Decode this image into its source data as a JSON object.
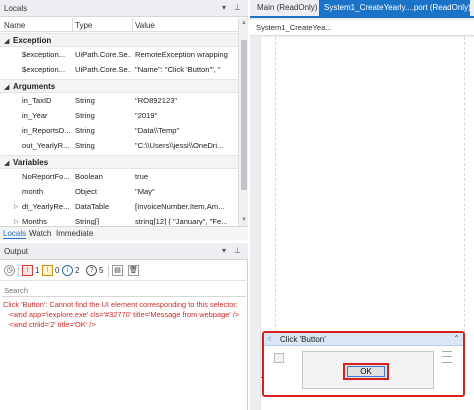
{
  "locals": {
    "title": "Locals",
    "columns": [
      "Name",
      "Type",
      "Value"
    ],
    "groups": [
      {
        "label": "Exception",
        "rows": [
          {
            "name": "$exception...",
            "type": "UiPath.Core.Se...",
            "value": "RemoteException wrapping"
          },
          {
            "name": "$exception...",
            "type": "UiPath.Core.Se...",
            "value": "\"Name\": \"Click 'Button'\",  \""
          }
        ]
      },
      {
        "label": "Arguments",
        "rows": [
          {
            "name": "in_TaxID",
            "type": "String",
            "value": "\"RO892123\""
          },
          {
            "name": "in_Year",
            "type": "String",
            "value": "\"2019\""
          },
          {
            "name": "in_ReportsD...",
            "type": "String",
            "value": "\"Data\\\\Temp\""
          },
          {
            "name": "out_YearlyR...",
            "type": "String",
            "value": "\"C:\\\\Users\\\\jessi\\\\OneDri..."
          }
        ]
      },
      {
        "label": "Variables",
        "rows": [
          {
            "name": "NoReportFo...",
            "type": "Boolean",
            "value": "true",
            "expand": false
          },
          {
            "name": "month",
            "type": "Object",
            "value": "\"May\"",
            "expand": false
          },
          {
            "name": "dt_YearlyRe...",
            "type": "DataTable",
            "value": "[InvoiceNumber,Item,Am...",
            "expand": true
          },
          {
            "name": "Months",
            "type": "String[]",
            "value": "string[12] { \"January\", \"Fe...",
            "expand": true
          }
        ]
      }
    ],
    "bottom_tabs": [
      "Locals",
      "Watch",
      "Immediate"
    ]
  },
  "output": {
    "title": "Output",
    "filters": {
      "errors": "1",
      "warnings": "0",
      "info": "2",
      "debug": "5"
    },
    "search_placeholder": "Search",
    "messages": [
      "Click 'Button': Cannot find the UI element corresponding to this selector:",
      "<wnd app='iexplore.exe' cls='#32770' title='Message from webpage' />",
      "<wnd ctrlid='2' title='OK' />"
    ]
  },
  "document": {
    "tabs": [
      {
        "label": "Main (ReadOnly)",
        "active": false
      },
      {
        "label": "System1_CreateYearly....port (ReadOnly)",
        "active": true
      }
    ],
    "breadcrumb": "System1_CreateYea...",
    "activity": {
      "title": "Click 'Button'",
      "preview_button": "OK"
    }
  },
  "colors": {
    "accent": "#1a73c7",
    "error": "#d12b2b",
    "highlight": "#d81e1e"
  }
}
